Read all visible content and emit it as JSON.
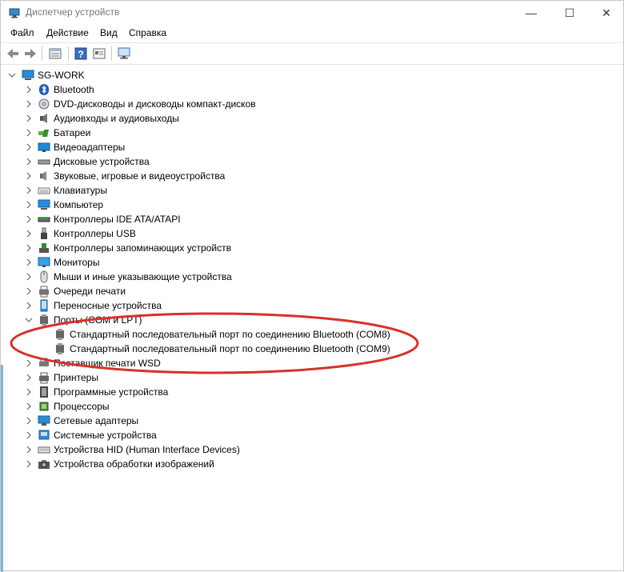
{
  "window": {
    "title": "Диспетчер устройств",
    "minimize": "—",
    "maximize": "☐",
    "close": "✕"
  },
  "menu": [
    "Файл",
    "Действие",
    "Вид",
    "Справка"
  ],
  "toolbar": [
    "back-icon",
    "forward-icon",
    "properties-icon",
    "help-icon",
    "view-icon",
    "scan-hardware-icon"
  ],
  "tree": {
    "root": "SG-WORK",
    "categories": [
      "Bluetooth",
      "DVD-дисководы и дисководы компакт-дисков",
      "Аудиовходы и аудиовыходы",
      "Батареи",
      "Видеоадаптеры",
      "Дисковые устройства",
      "Звуковые, игровые и видеоустройства",
      "Клавиатуры",
      "Компьютер",
      "Контроллеры IDE ATA/ATAPI",
      "Контроллеры USB",
      "Контроллеры запоминающих устройств",
      "Мониторы",
      "Мыши и иные указывающие устройства",
      "Очереди печати",
      "Переносные устройства",
      "Порты (COM и LPT)",
      "Поставщик печати WSD",
      "Принтеры",
      "Программные устройства",
      "Процессоры",
      "Сетевые адаптеры",
      "Системные устройства",
      "Устройства HID (Human Interface Devices)",
      "Устройства обработки изображений"
    ],
    "ports_children": [
      "Стандартный последовательный порт по соединению Bluetooth (COM8)",
      "Стандартный последовательный порт по соединению Bluetooth (COM9)"
    ]
  },
  "annotation_color": "#d9302a"
}
